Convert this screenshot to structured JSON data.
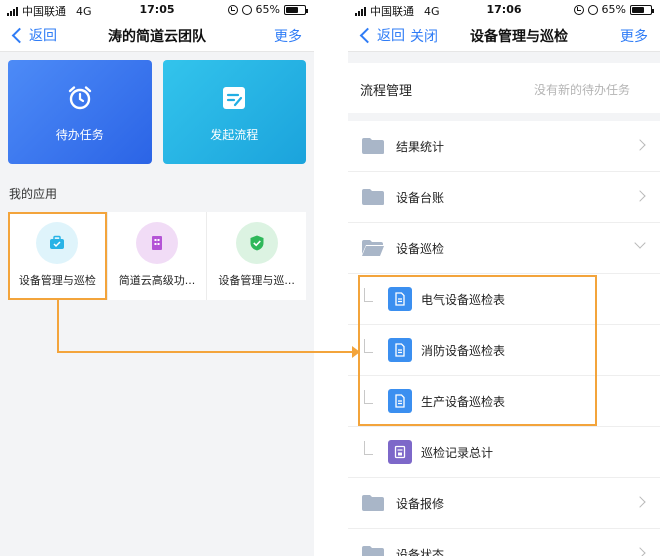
{
  "left_screen": {
    "status": {
      "carrier": "中国联通",
      "network": "4G",
      "time": "17:05",
      "battery": "65%"
    },
    "nav": {
      "back": "返回",
      "title": "涛的简道云团队",
      "more": "更多"
    },
    "tiles": [
      {
        "label": "待办任务",
        "icon": "alarm-clock-icon",
        "color": "#3b7bf0"
      },
      {
        "label": "发起流程",
        "icon": "edit-form-icon",
        "color": "#26b4e6"
      }
    ],
    "section_title": "我的应用",
    "apps": [
      {
        "label": "设备管理与巡检",
        "icon": "briefcase-icon",
        "bg": "#dff4fb",
        "fg": "#29b3e6"
      },
      {
        "label": "简道云高级功...",
        "icon": "building-icon",
        "bg": "#f1dcf6",
        "fg": "#b454d6"
      },
      {
        "label": "设备管理与巡...",
        "icon": "shield-check-icon",
        "bg": "#dcf3e2",
        "fg": "#2fb85a"
      }
    ]
  },
  "right_screen": {
    "status": {
      "carrier": "中国联通",
      "network": "4G",
      "time": "17:06",
      "battery": "65%"
    },
    "nav": {
      "back": "返回",
      "close": "关闭",
      "title": "设备管理与巡检",
      "more": "更多"
    },
    "process": {
      "title": "流程管理",
      "status": "没有新的待办任务"
    },
    "items": [
      {
        "type": "folder",
        "label": "结果统计",
        "state": "collapsed"
      },
      {
        "type": "folder",
        "label": "设备台账",
        "state": "collapsed"
      },
      {
        "type": "folder",
        "label": "设备巡检",
        "state": "expanded"
      },
      {
        "type": "form",
        "label": "电气设备巡检表",
        "icon_color": "#3b8ff0"
      },
      {
        "type": "form",
        "label": "消防设备巡检表",
        "icon_color": "#3b8ff0"
      },
      {
        "type": "form",
        "label": "生产设备巡检表",
        "icon_color": "#3b8ff0"
      },
      {
        "type": "report",
        "label": "巡检记录总计",
        "icon_color": "#7d68c9"
      },
      {
        "type": "folder",
        "label": "设备报修",
        "state": "collapsed"
      },
      {
        "type": "folder",
        "label": "设备状态",
        "state": "collapsed"
      }
    ]
  },
  "accent_colors": {
    "highlight": "#f3a43b",
    "link": "#2f7cf6"
  }
}
